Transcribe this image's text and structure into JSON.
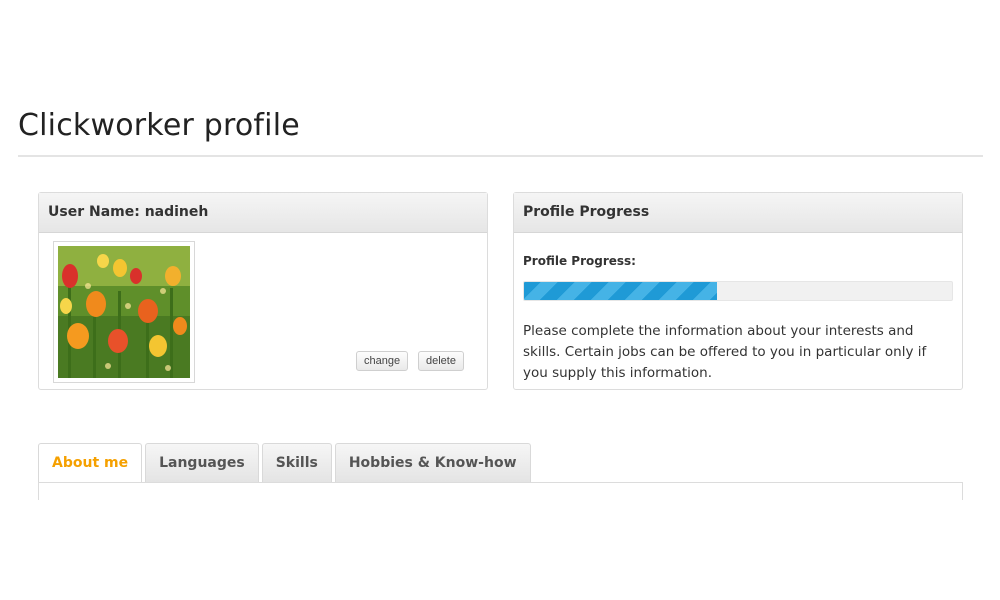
{
  "page": {
    "title": "Clickworker profile"
  },
  "user_panel": {
    "header": "User Name: nadineh",
    "avatar_alt": "flower photo",
    "change_label": "change",
    "delete_label": "delete"
  },
  "progress_panel": {
    "header": "Profile Progress",
    "label": "Profile Progress:",
    "progress_fraction": 0.45,
    "bar_color": "#1f9ad6",
    "message": "Please complete the information about your interests and skills. Certain jobs can be offered to you in particular only if you supply this information."
  },
  "tabs": [
    {
      "label": "About me",
      "active": true
    },
    {
      "label": "Languages",
      "active": false
    },
    {
      "label": "Skills",
      "active": false
    },
    {
      "label": "Hobbies & Know-how",
      "active": false
    }
  ],
  "colors": {
    "accent": "#f5a000",
    "progress": "#1f9ad6"
  }
}
